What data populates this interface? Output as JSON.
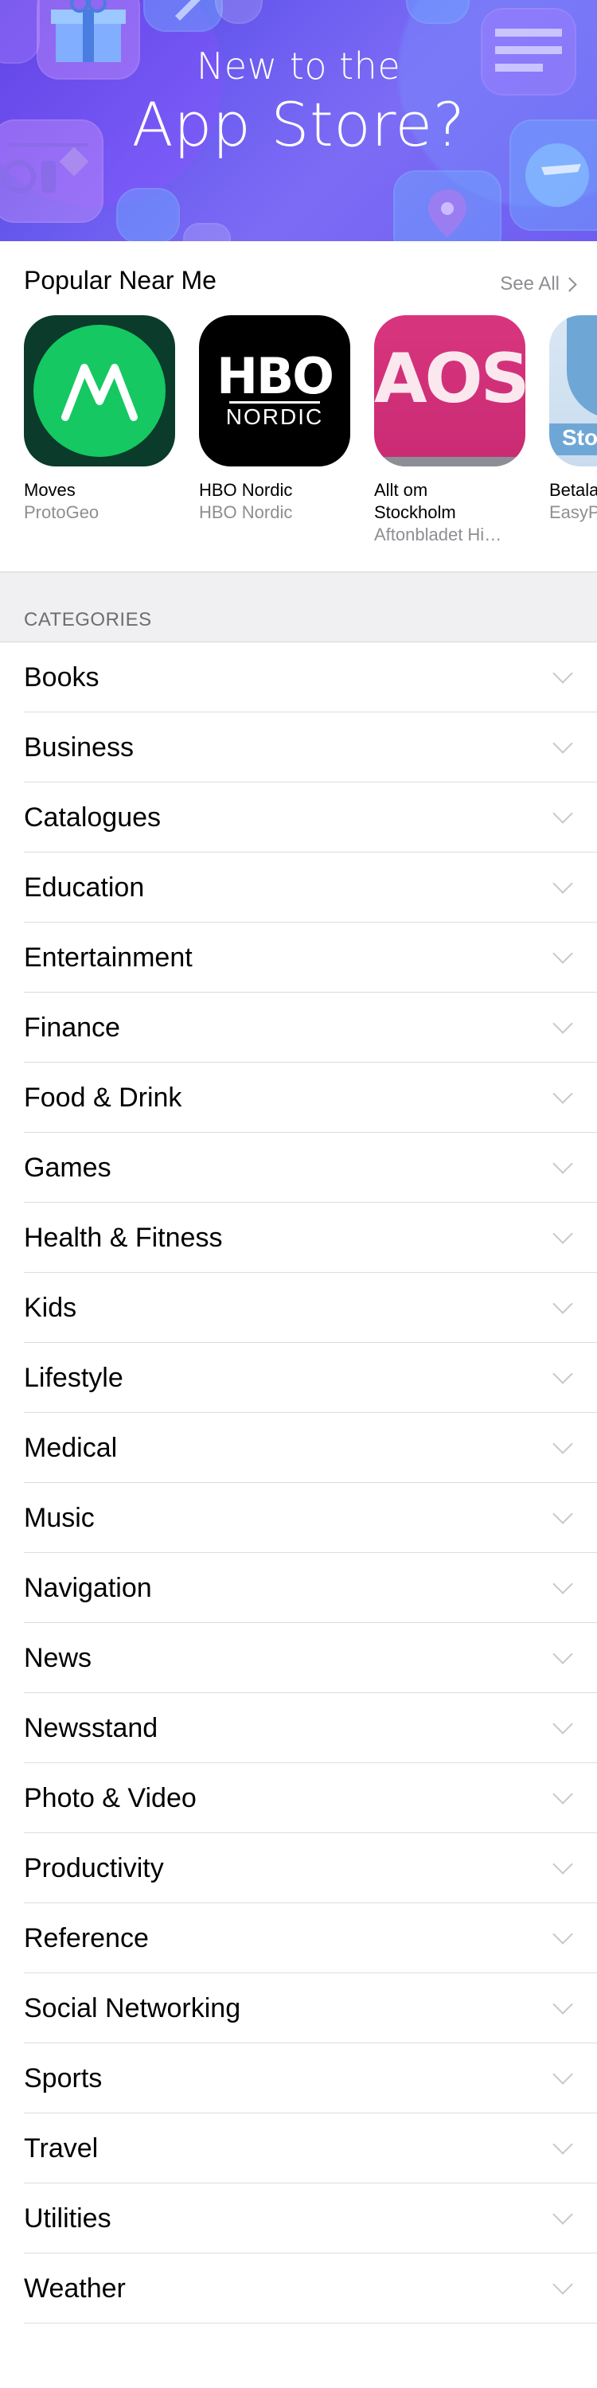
{
  "banner": {
    "line1": "New to the",
    "line2": "App Store?"
  },
  "popular": {
    "title": "Popular Near Me",
    "see_all": "See All",
    "apps": [
      {
        "name": "Moves",
        "developer": "ProtoGeo",
        "icon": "moves-icon"
      },
      {
        "name": "HBO Nordic",
        "developer": "HBO Nordic",
        "icon": "hbo-nordic-icon",
        "icon_text": "HBO",
        "icon_subtext": "NORDIC"
      },
      {
        "name": "Allt om",
        "name2": "Stockholm",
        "developer": "Aftonbladet Hi…",
        "icon": "aos-icon",
        "icon_text": "AOS"
      },
      {
        "name": "Betala",
        "developer": "EasyP",
        "icon": "betala-icon",
        "icon_text": "Sto"
      }
    ]
  },
  "categories": {
    "header": "CATEGORIES",
    "items": [
      "Books",
      "Business",
      "Catalogues",
      "Education",
      "Entertainment",
      "Finance",
      "Food & Drink",
      "Games",
      "Health & Fitness",
      "Kids",
      "Lifestyle",
      "Medical",
      "Music",
      "Navigation",
      "News",
      "Newsstand",
      "Photo & Video",
      "Productivity",
      "Reference",
      "Social Networking",
      "Sports",
      "Travel",
      "Utilities",
      "Weather"
    ]
  },
  "colors": {
    "banner_start": "#4a3fd8",
    "banner_end": "#7c6cf5",
    "secondary_text": "#8e8e93",
    "section_bg": "#f0f0f2"
  }
}
